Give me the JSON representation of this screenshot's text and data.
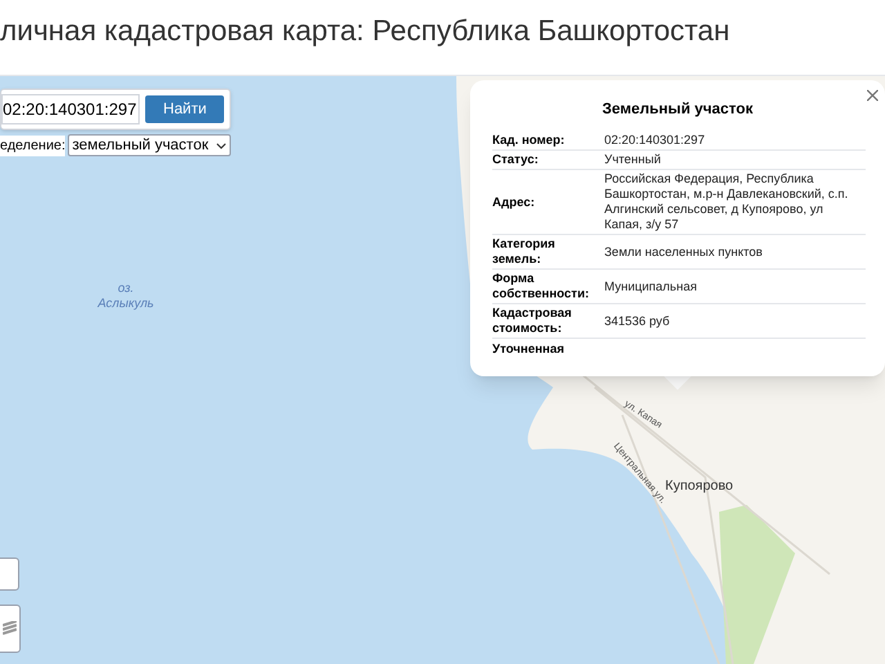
{
  "header": {
    "title": "личная кадастровая карта: Республика Башкортостан"
  },
  "search": {
    "value": "02:20:140301:297",
    "button": "Найти"
  },
  "filter": {
    "label": "еделение:",
    "value": "земельный участок"
  },
  "popup": {
    "title": "Земельный участок",
    "rows": [
      {
        "label": "Кад. номер:",
        "value": "02:20:140301:297"
      },
      {
        "label": "Статус:",
        "value": "Учтенный"
      },
      {
        "label": "Адрес:",
        "value": "Российская Федерация, Республика Башкортостан, м.р-н Давлекановский, с.п. Алгинский сельсовет, д Купоярово, ул Капая, з/у 57"
      },
      {
        "label": "Категория земель:",
        "value": "Земли населенных пунктов"
      },
      {
        "label": "Форма собственности:",
        "value": "Муниципальная"
      },
      {
        "label": "Кадастровая стоимость:",
        "value": "341536 руб"
      },
      {
        "label": "Уточненная"
      }
    ]
  },
  "map": {
    "labels": [
      {
        "kind": "lake",
        "text": "оз. Аслыкуль"
      },
      {
        "kind": "street",
        "text": "ул. Капая"
      },
      {
        "kind": "street",
        "text": "Центральная ул."
      },
      {
        "kind": "village",
        "text": "Купоярово"
      }
    ]
  }
}
